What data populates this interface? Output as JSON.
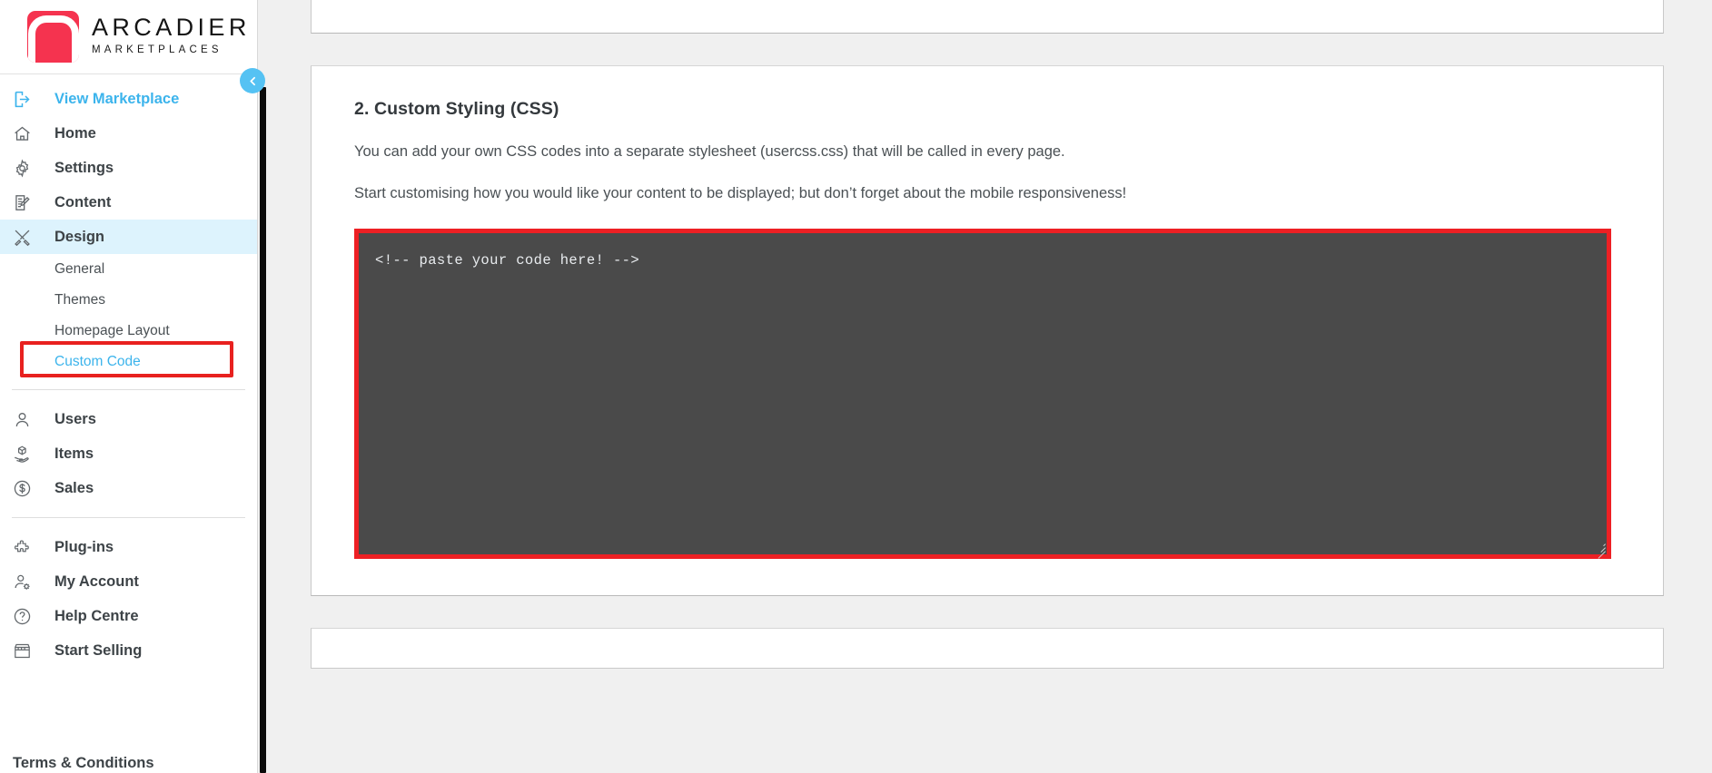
{
  "brand": {
    "title": "ARCADIER",
    "subtitle": "MARKETPLACES",
    "logo_color": "#f5334f",
    "accent_color": "#3cb4ec",
    "annotation_color": "#ed2024"
  },
  "sidebar": {
    "primary": [
      {
        "label": "View Marketplace",
        "icon": "exit-arrow-icon",
        "accent": true
      },
      {
        "label": "Home",
        "icon": "home-icon"
      },
      {
        "label": "Settings",
        "icon": "gear-icon"
      },
      {
        "label": "Content",
        "icon": "document-pencil-icon"
      },
      {
        "label": "Design",
        "icon": "brush-ruler-icon",
        "active": true
      }
    ],
    "design_subitems": [
      {
        "label": "General"
      },
      {
        "label": "Themes"
      },
      {
        "label": "Homepage Layout"
      },
      {
        "label": "Custom Code",
        "selected": true
      }
    ],
    "secondary": [
      {
        "label": "Users",
        "icon": "user-icon"
      },
      {
        "label": "Items",
        "icon": "item-hand-icon"
      },
      {
        "label": "Sales",
        "icon": "dollar-circle-icon"
      }
    ],
    "tertiary": [
      {
        "label": "Plug-ins",
        "icon": "puzzle-icon"
      },
      {
        "label": "My Account",
        "icon": "user-gear-icon"
      },
      {
        "label": "Help Centre",
        "icon": "question-circle-icon"
      },
      {
        "label": "Start Selling",
        "icon": "storefront-icon"
      }
    ],
    "footer_link": "Terms & Conditions",
    "collapse_icon": "chevron-left-icon"
  },
  "main": {
    "section": {
      "title": "2. Custom Styling (CSS)",
      "paragraph_1": "You can add your own CSS codes into a separate stylesheet (usercss.css) that will be called in every page.",
      "paragraph_2": "Start customising how you would like your content to be displayed; but don’t forget about the mobile responsiveness!",
      "code_value": "<!-- paste your code here! -->",
      "code_placeholder": "<!-- paste your code here! -->"
    }
  }
}
